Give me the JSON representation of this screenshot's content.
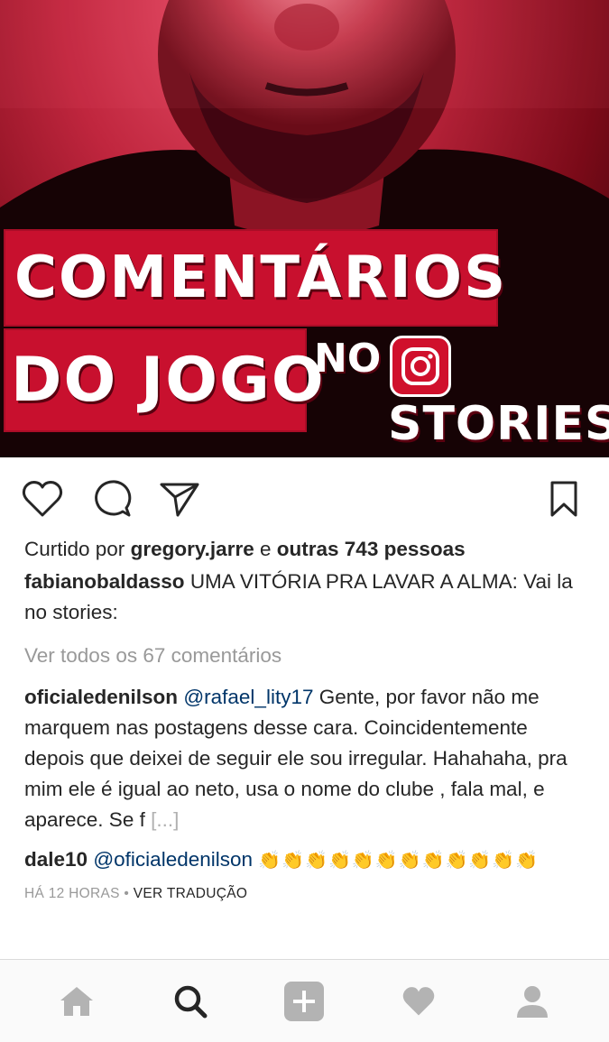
{
  "post": {
    "image": {
      "title_line1": "COMENTÁRIOS",
      "title_line2": "DO JOGO",
      "title_no": "NO",
      "title_stories": "STORIES"
    },
    "likes": {
      "prefix": "Curtido por",
      "user": "gregory.jarre",
      "connector": "e",
      "others": "outras 743 pessoas"
    },
    "caption": {
      "user": "fabianobaldasso",
      "text": "UMA VITÓRIA PRA LAVAR A ALMA: Vai la no stories:"
    },
    "view_all_comments": "Ver todos os 67 comentários",
    "comments": [
      {
        "user": "oficialedenilson",
        "mention": "@rafael_lity17",
        "text": "Gente, por favor não me marquem nas postagens desse cara. Coincidentemente depois que deixei de seguir ele sou irregular. Hahahaha, pra mim ele é igual ao neto, usa o nome do clube , fala mal, e aparece. Se f",
        "more": "[...]"
      },
      {
        "user": "dale10",
        "mention": "@oficialedenilson",
        "emojis": "👏👏👏👏👏👏👏👏👏👏👏👏"
      }
    ],
    "timestamp": "HÁ 12 HORAS",
    "separator": "•",
    "translate": "VER TRADUÇÃO"
  },
  "icons": {
    "like": "heart-outline-icon",
    "comment": "speech-bubble-icon",
    "share": "paper-plane-icon",
    "save": "bookmark-icon",
    "nav_home": "home-icon",
    "nav_search": "search-icon",
    "nav_add": "plus-square-icon",
    "nav_activity": "heart-filled-icon",
    "nav_profile": "profile-icon"
  },
  "colors": {
    "text": "#262626",
    "muted": "#999999",
    "mention": "#003569",
    "brand_red": "#c8102e"
  }
}
